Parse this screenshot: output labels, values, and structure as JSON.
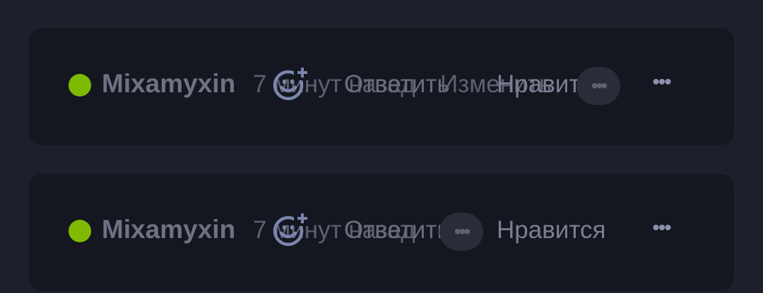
{
  "comments": [
    {
      "author": "Mixamyxin",
      "time": "7 минут назад",
      "reply_label": "Ответить",
      "edit_label": "Изменить",
      "like_label": "Нравится",
      "pill_icon": "•••",
      "menu_icon": "•••"
    },
    {
      "author": "Mixamyxin",
      "time": "7 минут назад",
      "reply_label": "Ответить",
      "like_label": "Нравится",
      "pill_icon": "•••",
      "menu_icon": "•••"
    }
  ],
  "colors": {
    "online": "#7fba00",
    "background": "#1d1f2a",
    "card": "#141620"
  },
  "icons": {
    "reaction": "add-reaction-icon",
    "more": "more-options-icon"
  }
}
